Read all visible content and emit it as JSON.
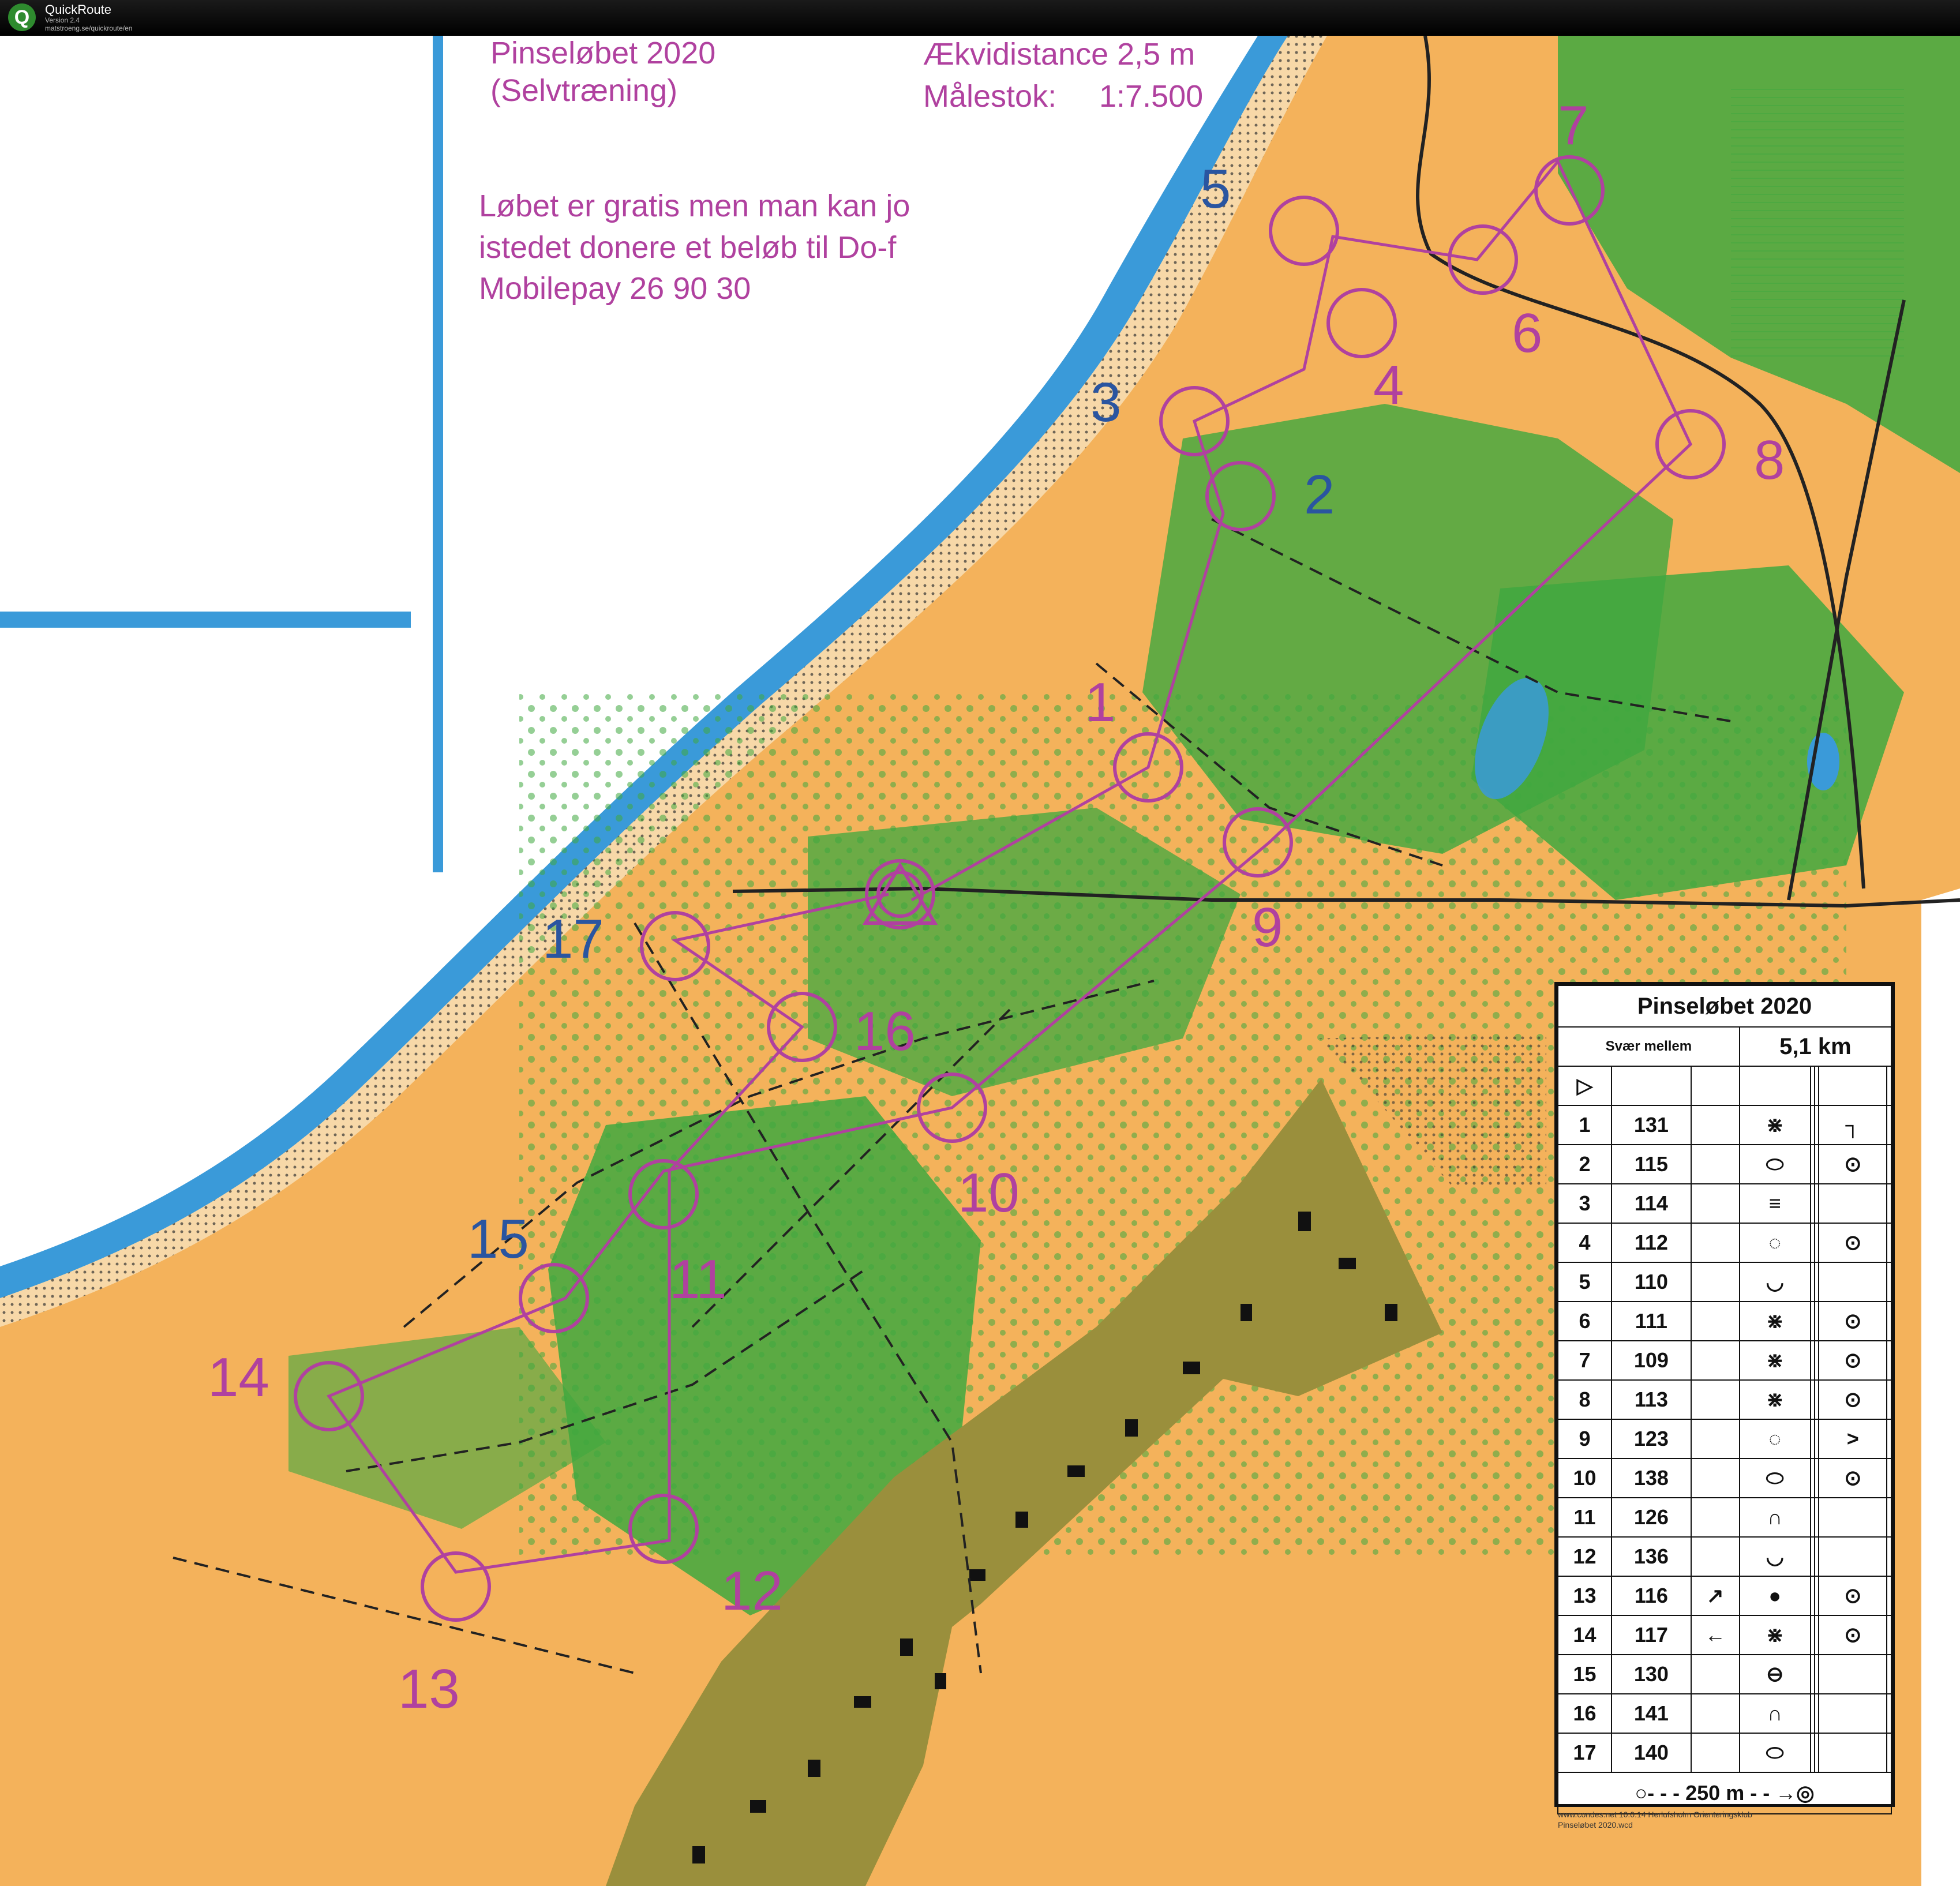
{
  "app": {
    "name": "QuickRoute",
    "version": "Version 2.4",
    "url": "matstroeng.se/quickroute/en"
  },
  "map": {
    "title": "Pinseløbet 2020",
    "subtitle": "(Selvtræning)",
    "contour": "Ækvidistance 2,5 m",
    "scale_label": "Målestok:",
    "scale": "1:7.500",
    "note1": "Løbet er gratis men man kan jo",
    "note2": "istedet donere et beløb til Do-f",
    "note3": "Mobilepay 26 90 30",
    "controls": [
      "1",
      "2",
      "3",
      "4",
      "5",
      "6",
      "7",
      "8",
      "9",
      "10",
      "11",
      "12",
      "13",
      "14",
      "15",
      "16",
      "17"
    ],
    "colors": {
      "open_land": "#f4b25b",
      "forest": "#3fa83f",
      "water": "#3a9ad9",
      "urban": "#9a8f3c",
      "course": "#b0419f"
    }
  },
  "description": {
    "title": "Pinseløbet 2020",
    "level": "Svær mellem",
    "length": "5,1 km",
    "start_symbol": "▷",
    "rows": [
      {
        "n": "1",
        "code": "131",
        "dir": "",
        "feature": "⋇",
        "extra": "┐"
      },
      {
        "n": "2",
        "code": "115",
        "dir": "",
        "feature": "⬭",
        "extra": "⊙"
      },
      {
        "n": "3",
        "code": "114",
        "dir": "",
        "feature": "≡",
        "extra": ""
      },
      {
        "n": "4",
        "code": "112",
        "dir": "",
        "feature": "◌",
        "extra": "⊙"
      },
      {
        "n": "5",
        "code": "110",
        "dir": "",
        "feature": "◡",
        "extra": ""
      },
      {
        "n": "6",
        "code": "111",
        "dir": "",
        "feature": "⋇",
        "extra": "⊙"
      },
      {
        "n": "7",
        "code": "109",
        "dir": "",
        "feature": "⋇",
        "extra": "⊙"
      },
      {
        "n": "8",
        "code": "113",
        "dir": "",
        "feature": "⋇",
        "extra": "⊙"
      },
      {
        "n": "9",
        "code": "123",
        "dir": "",
        "feature": "◌",
        "extra": ">"
      },
      {
        "n": "10",
        "code": "138",
        "dir": "",
        "feature": "⬭",
        "extra": "⊙"
      },
      {
        "n": "11",
        "code": "126",
        "dir": "",
        "feature": "∩",
        "extra": ""
      },
      {
        "n": "12",
        "code": "136",
        "dir": "",
        "feature": "◡",
        "extra": ""
      },
      {
        "n": "13",
        "code": "116",
        "dir": "↗",
        "feature": "●",
        "extra": "⊙"
      },
      {
        "n": "14",
        "code": "117",
        "dir": "←",
        "feature": "⋇",
        "extra": "⊙"
      },
      {
        "n": "15",
        "code": "130",
        "dir": "",
        "feature": "⊖",
        "extra": ""
      },
      {
        "n": "16",
        "code": "141",
        "dir": "",
        "feature": "∩",
        "extra": ""
      },
      {
        "n": "17",
        "code": "140",
        "dir": "",
        "feature": "⬭",
        "extra": ""
      }
    ],
    "finish": "○- - - 250 m - - →◎"
  },
  "credit": {
    "line1": "www.condes.net 10.0.14 Herlufsholm Orienteringsklub",
    "line2": "Pinseløbet 2020.wcd"
  }
}
